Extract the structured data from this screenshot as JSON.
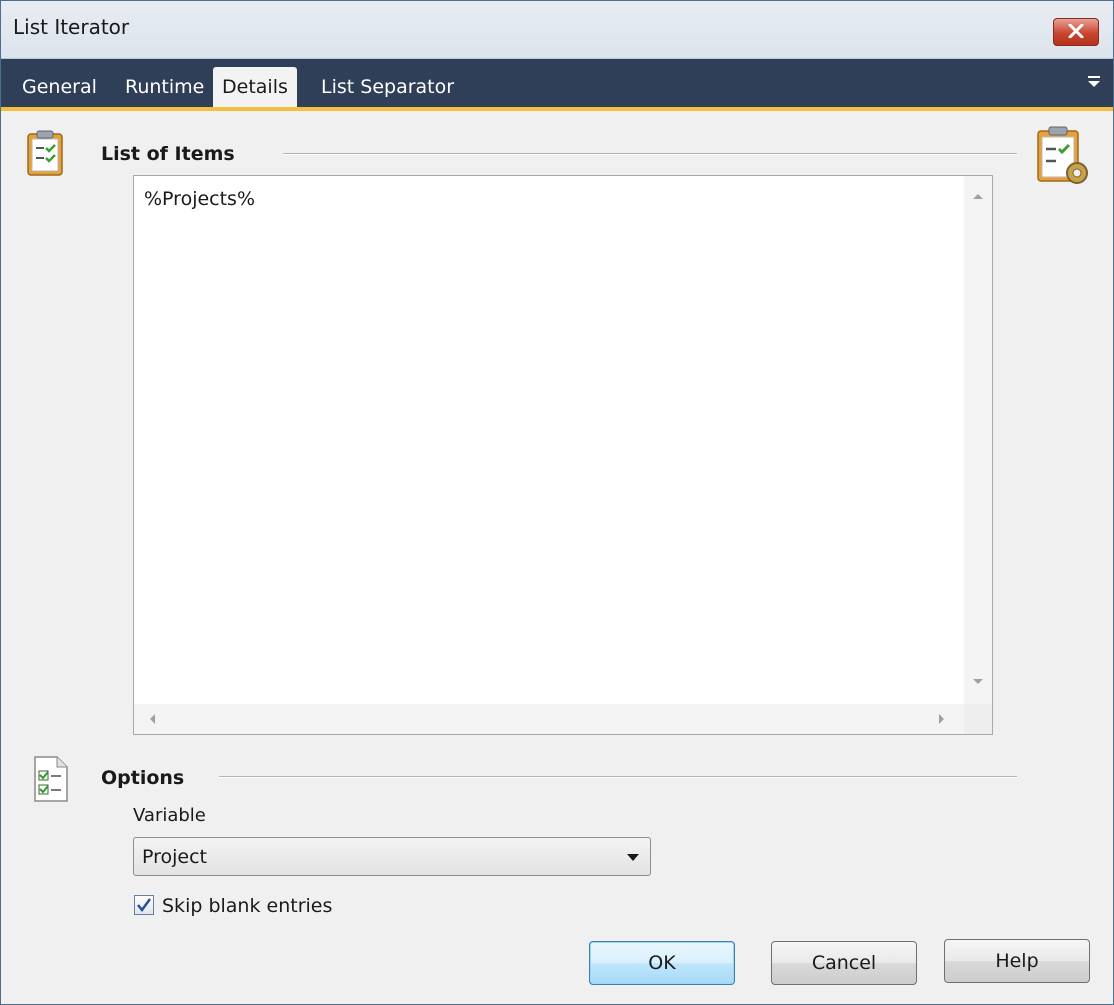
{
  "window": {
    "title": "List Iterator"
  },
  "tabs": [
    {
      "label": "General",
      "active": false
    },
    {
      "label": "Runtime",
      "active": false
    },
    {
      "label": "Details",
      "active": true
    },
    {
      "label": "List Separator",
      "active": false
    }
  ],
  "list_section": {
    "title": "List of Items",
    "content": "%Projects%"
  },
  "options_section": {
    "title": "Options",
    "variable_label": "Variable",
    "variable_value": "Project",
    "skip_blank_label": "Skip blank entries",
    "skip_blank_checked": true
  },
  "buttons": {
    "ok": "OK",
    "cancel": "Cancel",
    "help": "Help"
  },
  "colors": {
    "tab_bar": "#2f3f58",
    "tab_accent": "#f2bf40",
    "close_button": "#c8462f"
  },
  "icons": {
    "title_close": "close-icon",
    "tab_menu": "menu-dropdown-icon",
    "list_section": "clipboard-checklist-icon",
    "list_action": "clipboard-gear-icon",
    "options_section": "checklist-document-icon"
  }
}
